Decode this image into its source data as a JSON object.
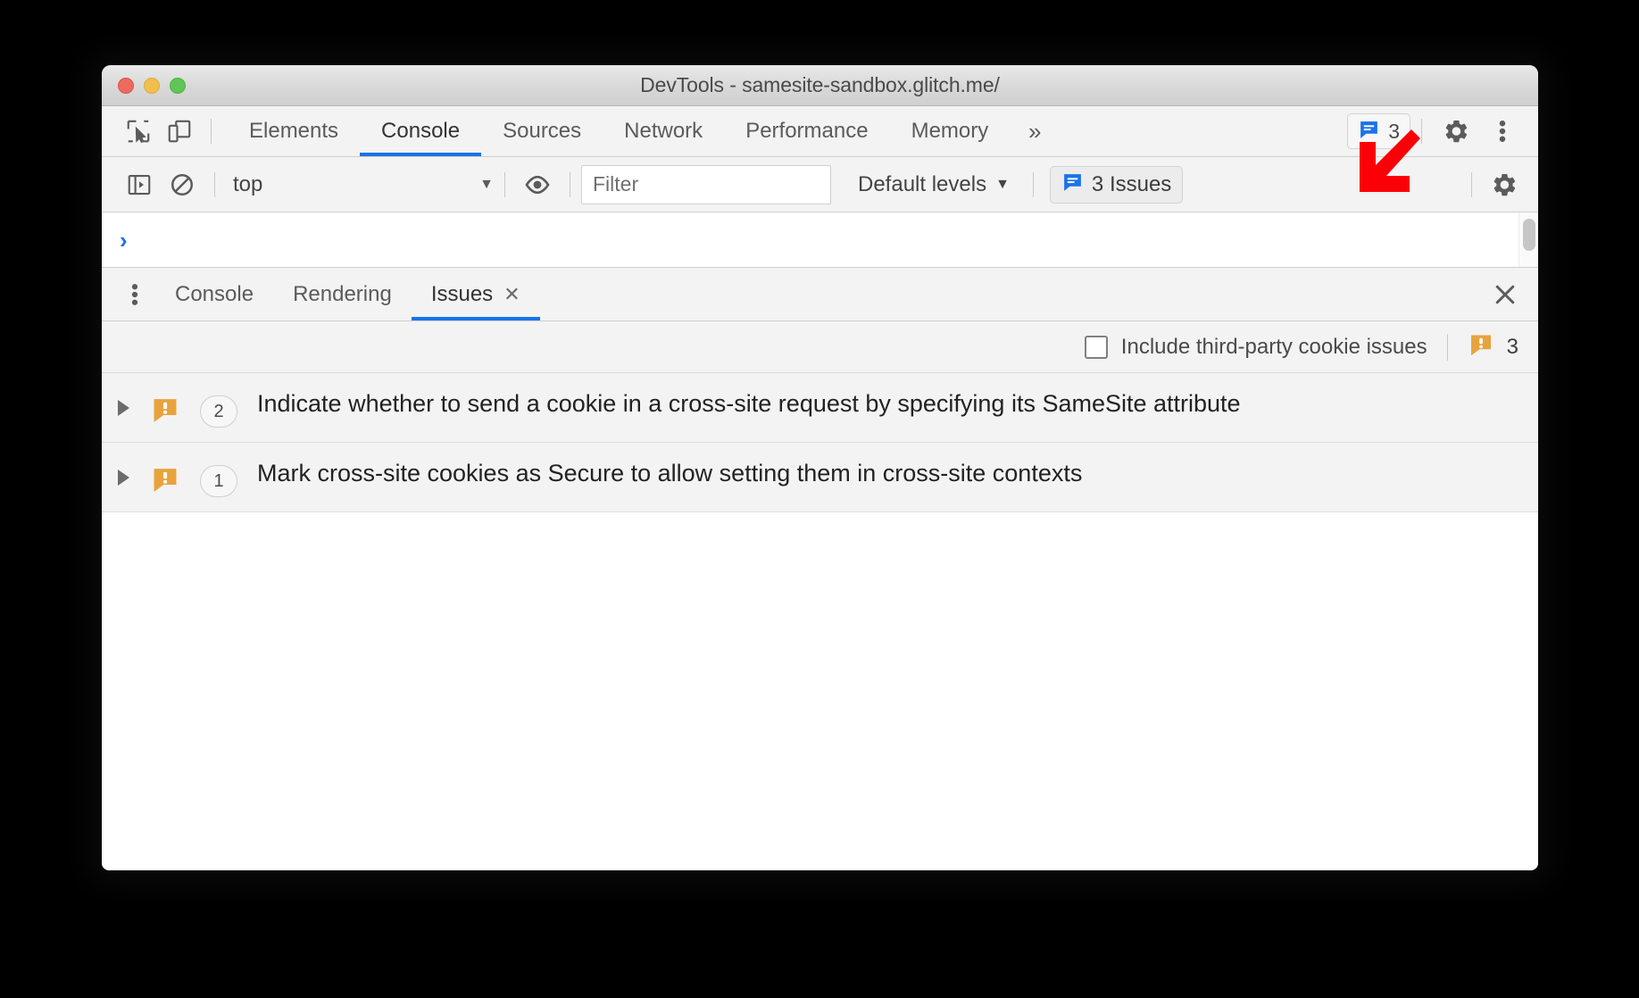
{
  "window": {
    "title": "DevTools - samesite-sandbox.glitch.me/",
    "traffic_lights": [
      "close",
      "minimize",
      "maximize"
    ]
  },
  "main_tabs": {
    "inspect_icon": "inspect-cursor-icon",
    "device_icon": "device-toolbar-icon",
    "items": [
      {
        "label": "Elements",
        "active": false
      },
      {
        "label": "Console",
        "active": true
      },
      {
        "label": "Sources",
        "active": false
      },
      {
        "label": "Network",
        "active": false
      },
      {
        "label": "Performance",
        "active": false
      },
      {
        "label": "Memory",
        "active": false
      }
    ],
    "more_label": "»",
    "issues_badge": {
      "icon": "issue-message-icon",
      "count": "3"
    },
    "settings_icon": "gear-icon",
    "more_options_icon": "kebab-menu-icon"
  },
  "console_toolbar": {
    "sidebar_icon": "console-sidebar-icon",
    "clear_icon": "clear-console-icon",
    "context": "top",
    "context_caret": "▼",
    "eye_icon": "live-expression-eye-icon",
    "filter_placeholder": "Filter",
    "filter_value": "",
    "levels_label": "Default levels",
    "levels_caret": "▼",
    "issues_button": {
      "icon": "issue-message-icon",
      "label": "3 Issues"
    },
    "settings_icon": "gear-icon"
  },
  "console_output": {
    "prompt": "›"
  },
  "drawer": {
    "kebab_icon": "drawer-kebab-icon",
    "tabs": [
      {
        "label": "Console",
        "active": false,
        "closable": false
      },
      {
        "label": "Rendering",
        "active": false,
        "closable": false
      },
      {
        "label": "Issues",
        "active": true,
        "closable": true,
        "close_glyph": "✕"
      }
    ],
    "close_glyph": "✕"
  },
  "issues_toolbar": {
    "checkbox_label": "Include third-party cookie issues",
    "checkbox_checked": false,
    "warning_icon": "issue-warning-icon",
    "count": "3"
  },
  "issues": [
    {
      "expander": "collapsed-triangle-icon",
      "icon": "issue-warning-icon",
      "count": "2",
      "title": "Indicate whether to send a cookie in a cross-site request by specifying its SameSite attribute"
    },
    {
      "expander": "collapsed-triangle-icon",
      "icon": "issue-warning-icon",
      "count": "1",
      "title": "Mark cross-site cookies as Secure to allow setting them in cross-site contexts"
    }
  ],
  "annotation": {
    "arrow": "red-arrow-pointing-down-left",
    "color": "#fb0007"
  },
  "colors": {
    "accent_blue": "#1a73e8",
    "warning_orange": "#e8a33d",
    "toolbar_bg": "#f3f3f3",
    "row_bg": "#f3f3f3",
    "annotation_red": "#fb0007"
  }
}
